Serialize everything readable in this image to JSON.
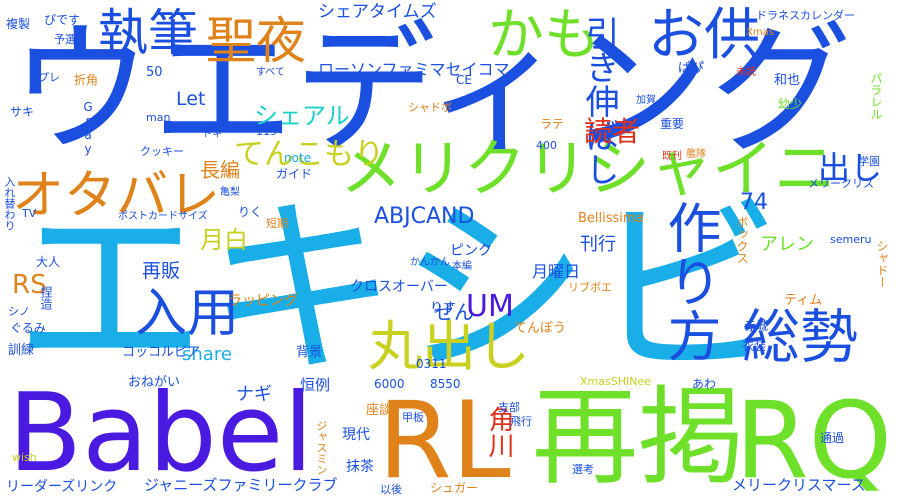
{
  "palette": {
    "blue": "#1a4fe0",
    "cyan": "#1aaee8",
    "green": "#6ee02a",
    "orange": "#e0821a",
    "red": "#e0321a",
    "purple": "#4a1ae0",
    "teal": "#1ad0c8",
    "yellow": "#c8d020"
  },
  "words": [
    {
      "id": "w1",
      "text": "エキシビ",
      "color": "cyan"
    },
    {
      "id": "w2",
      "text": "ウエディング",
      "color": "blue"
    },
    {
      "id": "w3",
      "text": "Babel",
      "color": "purple"
    },
    {
      "id": "w4",
      "text": "再掲",
      "color": "green"
    },
    {
      "id": "w5",
      "text": "RL",
      "color": "orange"
    },
    {
      "id": "w6",
      "text": "RQ",
      "color": "green"
    },
    {
      "id": "w7",
      "text": "メリクリシャイニ",
      "color": "green"
    },
    {
      "id": "w8",
      "text": "オタバレ",
      "color": "orange"
    },
    {
      "id": "w9",
      "text": "総勢",
      "color": "blue"
    },
    {
      "id": "w10",
      "text": "丸出し",
      "color": "yellow"
    },
    {
      "id": "w11",
      "text": "作り方",
      "color": "blue"
    },
    {
      "id": "w12",
      "text": "入用",
      "color": "blue"
    },
    {
      "id": "w13",
      "text": "聖夜",
      "color": "orange"
    },
    {
      "id": "w14",
      "text": "執筆",
      "color": "blue"
    },
    {
      "id": "w15",
      "text": "かも",
      "color": "green"
    },
    {
      "id": "w16",
      "text": "お供",
      "color": "blue"
    },
    {
      "id": "w17",
      "text": "引き伸ばし",
      "color": "blue"
    },
    {
      "id": "w18",
      "text": "てんこもり",
      "color": "yellow"
    },
    {
      "id": "w19",
      "text": "出し",
      "color": "blue"
    },
    {
      "id": "w20",
      "text": "読者",
      "color": "red"
    },
    {
      "id": "w21",
      "text": "UM",
      "color": "purple"
    },
    {
      "id": "w22",
      "text": "月白",
      "color": "yellow"
    },
    {
      "id": "w23",
      "text": "RS",
      "color": "orange"
    },
    {
      "id": "w24",
      "text": "シェアル",
      "color": "teal"
    },
    {
      "id": "w25",
      "text": "ABJCAND",
      "color": "blue"
    },
    {
      "id": "w26",
      "text": "74",
      "color": "blue"
    },
    {
      "id": "w27",
      "text": "share",
      "color": "cyan"
    },
    {
      "id": "w28",
      "text": "シェアタイムズ",
      "color": "blue"
    },
    {
      "id": "w29",
      "text": "ローソンファミマセイコマ",
      "color": "blue"
    },
    {
      "id": "w30",
      "text": "メリークリスマース",
      "color": "blue"
    },
    {
      "id": "w31",
      "text": "ジャニーズファミリークラブ",
      "color": "blue"
    },
    {
      "id": "w32",
      "text": "リーダーズリンク",
      "color": "blue"
    },
    {
      "id": "w33",
      "text": "長編",
      "color": "orange"
    },
    {
      "id": "w34",
      "text": "再販",
      "color": "blue"
    },
    {
      "id": "w35",
      "text": "ぜん",
      "color": "blue"
    },
    {
      "id": "w36",
      "text": "Let",
      "color": "blue"
    },
    {
      "id": "w37",
      "text": "ナギ",
      "color": "blue"
    },
    {
      "id": "w38",
      "text": "角川",
      "color": "red"
    },
    {
      "id": "w39",
      "text": "刊行",
      "color": "blue"
    },
    {
      "id": "w40",
      "text": "月曜日",
      "color": "blue"
    },
    {
      "id": "w41",
      "text": "アレン",
      "color": "green"
    },
    {
      "id": "w42",
      "text": "クロスオーバー",
      "color": "blue"
    },
    {
      "id": "w43",
      "text": "ラッピング",
      "color": "orange"
    },
    {
      "id": "w44",
      "text": "コッコルピア",
      "color": "blue"
    },
    {
      "id": "w45",
      "text": "おねがい",
      "color": "blue"
    },
    {
      "id": "w46",
      "text": "恒例",
      "color": "blue"
    },
    {
      "id": "w47",
      "text": "背景",
      "color": "blue"
    },
    {
      "id": "w48",
      "text": "現代",
      "color": "blue"
    },
    {
      "id": "w49",
      "text": "抹茶",
      "color": "blue"
    },
    {
      "id": "w50",
      "text": "座談",
      "color": "orange"
    },
    {
      "id": "w51",
      "text": "Bellissima",
      "color": "orange"
    },
    {
      "id": "w52",
      "text": "ボックス",
      "color": "orange"
    },
    {
      "id": "w53",
      "text": "ピンク",
      "color": "blue"
    },
    {
      "id": "w54",
      "text": "ティム",
      "color": "orange"
    },
    {
      "id": "w55",
      "text": "りす",
      "color": "blue"
    },
    {
      "id": "w56",
      "text": "てんぼう",
      "color": "orange"
    },
    {
      "id": "w57",
      "text": "0311",
      "color": "blue"
    },
    {
      "id": "w58",
      "text": "6000",
      "color": "blue"
    },
    {
      "id": "w59",
      "text": "8550",
      "color": "blue"
    },
    {
      "id": "w60",
      "text": "衣装",
      "color": "blue"
    },
    {
      "id": "w61",
      "text": "赤城",
      "color": "blue"
    },
    {
      "id": "w62",
      "text": "あわ",
      "color": "blue"
    },
    {
      "id": "w63",
      "text": "XmasSHINee",
      "color": "yellow"
    },
    {
      "id": "w64",
      "text": "支部",
      "color": "blue"
    },
    {
      "id": "w65",
      "text": "甲板",
      "color": "blue"
    },
    {
      "id": "w66",
      "text": "飛行",
      "color": "blue"
    },
    {
      "id": "w67",
      "text": "通過",
      "color": "blue"
    },
    {
      "id": "w68",
      "text": "選考",
      "color": "blue"
    },
    {
      "id": "w69",
      "text": "シュガー",
      "color": "orange"
    },
    {
      "id": "w70",
      "text": "以後",
      "color": "blue"
    },
    {
      "id": "w71",
      "text": "ジャスミン",
      "color": "orange"
    },
    {
      "id": "w72",
      "text": "wish",
      "color": "yellow"
    },
    {
      "id": "w73",
      "text": "訓練",
      "color": "blue"
    },
    {
      "id": "w74",
      "text": "ぐるみ",
      "color": "blue"
    },
    {
      "id": "w75",
      "text": "シノ",
      "color": "blue"
    },
    {
      "id": "w76",
      "text": "捏造",
      "color": "blue"
    },
    {
      "id": "w77",
      "text": "大人",
      "color": "blue"
    },
    {
      "id": "w78",
      "text": "TV",
      "color": "blue"
    },
    {
      "id": "w79",
      "text": "入れ替わり",
      "color": "blue"
    },
    {
      "id": "w80",
      "text": "ポストカードサイズ",
      "color": "blue"
    },
    {
      "id": "w81",
      "text": "りく",
      "color": "blue"
    },
    {
      "id": "w82",
      "text": "短期",
      "color": "orange"
    },
    {
      "id": "w83",
      "text": "ガイド",
      "color": "blue"
    },
    {
      "id": "w84",
      "text": "亀梨",
      "color": "blue"
    },
    {
      "id": "w85",
      "text": "note",
      "color": "cyan"
    },
    {
      "id": "w86",
      "text": "クッキー",
      "color": "blue"
    },
    {
      "id": "w87",
      "text": "トキ",
      "color": "blue"
    },
    {
      "id": "w88",
      "text": "119",
      "color": "blue"
    },
    {
      "id": "w89",
      "text": "man",
      "color": "blue"
    },
    {
      "id": "w90",
      "text": "Gray",
      "color": "blue"
    },
    {
      "id": "w91",
      "text": "サキ",
      "color": "blue"
    },
    {
      "id": "w92",
      "text": "折角",
      "color": "orange"
    },
    {
      "id": "w93",
      "text": "プレ",
      "color": "blue"
    },
    {
      "id": "w94",
      "text": "50",
      "color": "blue"
    },
    {
      "id": "w95",
      "text": "すべて",
      "color": "blue"
    },
    {
      "id": "w96",
      "text": "CE",
      "color": "blue"
    },
    {
      "id": "w97",
      "text": "シャドボ",
      "color": "orange"
    },
    {
      "id": "w98",
      "text": "ラテ",
      "color": "orange"
    },
    {
      "id": "w99",
      "text": "400",
      "color": "blue"
    },
    {
      "id": "w100",
      "text": "重要",
      "color": "blue"
    },
    {
      "id": "w101",
      "text": "加賀",
      "color": "blue"
    },
    {
      "id": "w102",
      "text": "ぱぴ",
      "color": "blue"
    },
    {
      "id": "w103",
      "text": "未読",
      "color": "red"
    },
    {
      "id": "w104",
      "text": "和也",
      "color": "blue"
    },
    {
      "id": "w105",
      "text": "幼少",
      "color": "green"
    },
    {
      "id": "w106",
      "text": "パラレル",
      "color": "green"
    },
    {
      "id": "w107",
      "text": "艦隊",
      "color": "orange"
    },
    {
      "id": "w108",
      "text": "既刊",
      "color": "red"
    },
    {
      "id": "w109",
      "text": "学園",
      "color": "blue"
    },
    {
      "id": "w110",
      "text": "メリークリス",
      "color": "blue"
    },
    {
      "id": "w111",
      "text": "Xmas",
      "color": "orange"
    },
    {
      "id": "w112",
      "text": "ドラネスカレンダー",
      "color": "blue"
    },
    {
      "id": "w113",
      "text": "ぴです",
      "color": "blue"
    },
    {
      "id": "w114",
      "text": "複製",
      "color": "blue"
    },
    {
      "id": "w115",
      "text": "予選",
      "color": "blue"
    },
    {
      "id": "w116",
      "text": "semeru",
      "color": "blue"
    },
    {
      "id": "w117",
      "text": "シャドー",
      "color": "orange"
    },
    {
      "id": "w118",
      "text": "リブボエ",
      "color": "orange"
    },
    {
      "id": "w119",
      "text": "本編",
      "color": "blue"
    },
    {
      "id": "w120",
      "text": "かんかん",
      "color": "blue"
    }
  ]
}
